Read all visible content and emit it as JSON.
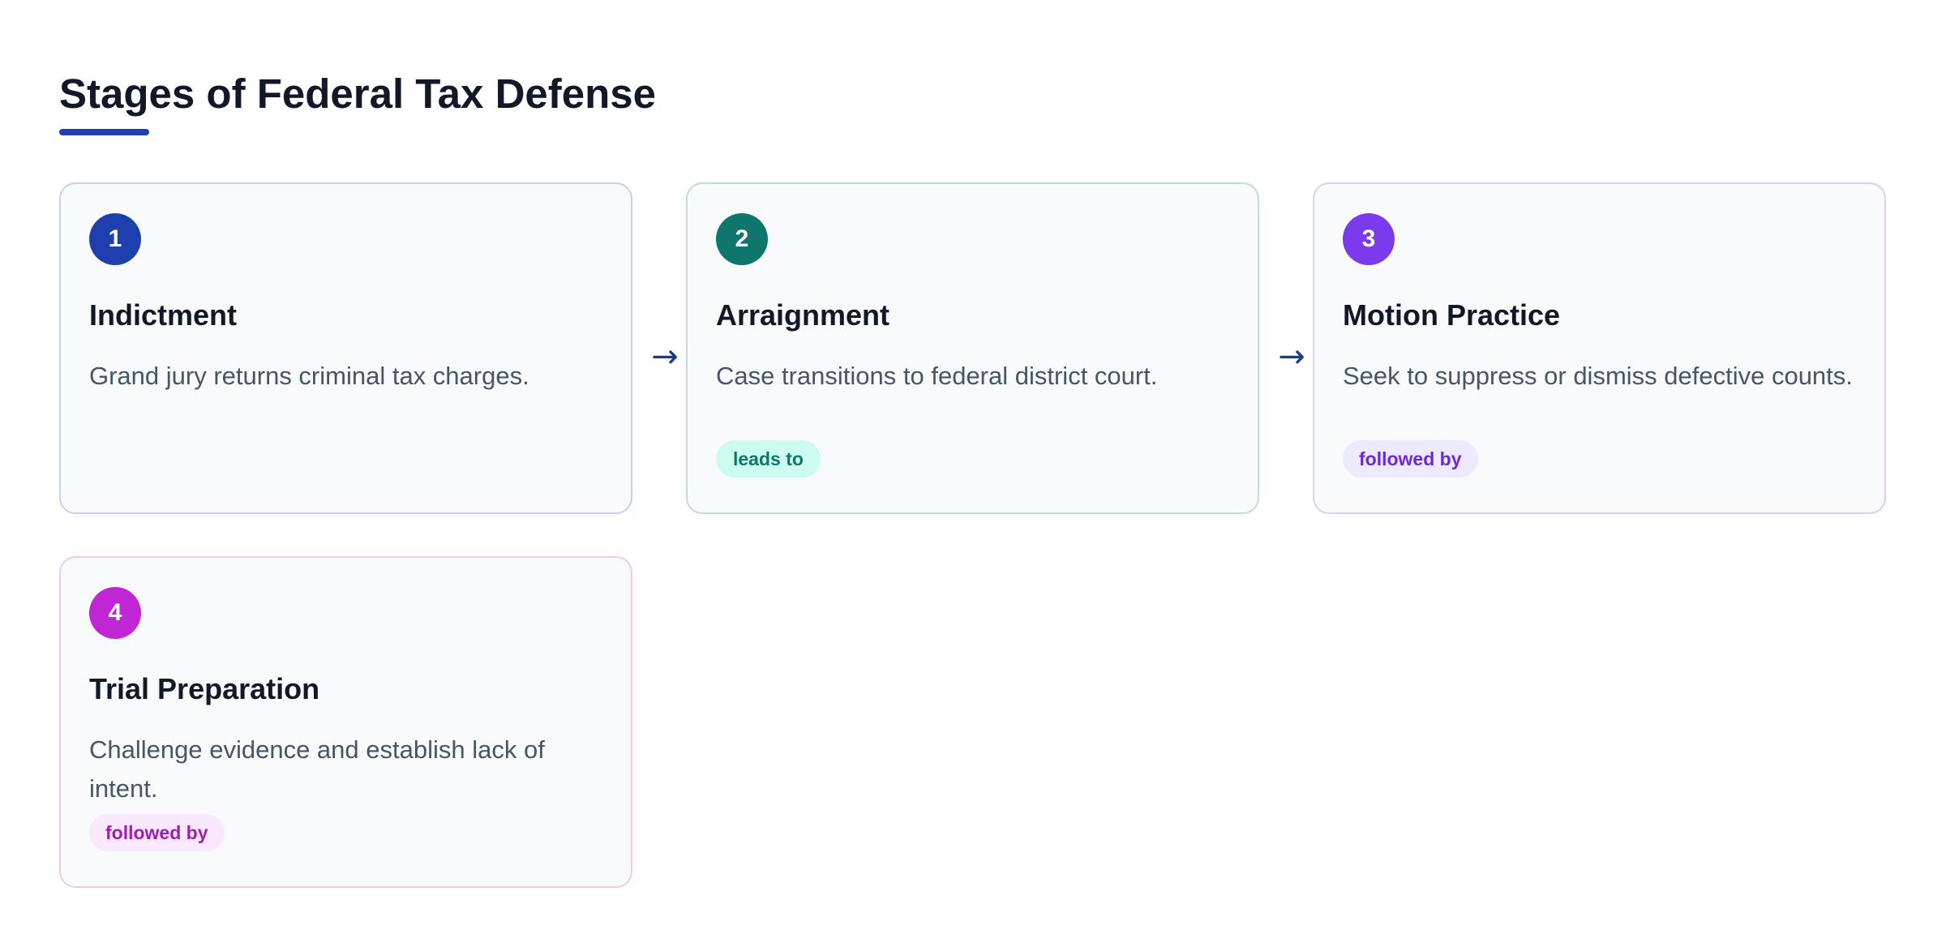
{
  "page": {
    "title": "Stages of Federal Tax Defense"
  },
  "connector_icon": "arrow-right",
  "stages": [
    {
      "number": "1",
      "title": "Indictment",
      "description": "Grand jury returns criminal tax charges.",
      "color": "#1e40af"
    },
    {
      "number": "2",
      "title": "Arraignment",
      "description": "Case transitions to federal district court.",
      "badge": "leads to",
      "color": "#0f766e"
    },
    {
      "number": "3",
      "title": "Motion Practice",
      "description": "Seek to suppress or dismiss defective counts.",
      "badge": "followed by",
      "color": "#7c3aed"
    },
    {
      "number": "4",
      "title": "Trial Preparation",
      "description": "Challenge evidence and establish lack of intent.",
      "badge": "followed by",
      "color": "#c026d3"
    }
  ]
}
